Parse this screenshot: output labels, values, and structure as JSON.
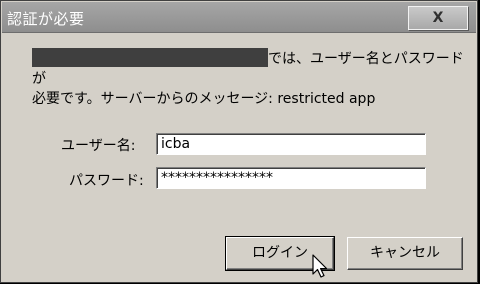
{
  "window": {
    "title": "認証が必要",
    "close_label": "X"
  },
  "message": {
    "line1_suffix": "では、ユーザー名とパスワードが",
    "line2": "必要です。サーバーからのメッセージ: restricted app"
  },
  "form": {
    "username_label": "ユーザー名:",
    "username_value": "icba",
    "password_label": "パスワード:",
    "password_value": "****************"
  },
  "buttons": {
    "login": "ログイン",
    "cancel": "キャンセル"
  },
  "colors": {
    "dialog_bg": "#d4d0c8",
    "titlebar": "#9a9a9a",
    "redaction": "#3f3f3f"
  },
  "icons": {
    "cursor": "mouse-pointer-icon"
  }
}
